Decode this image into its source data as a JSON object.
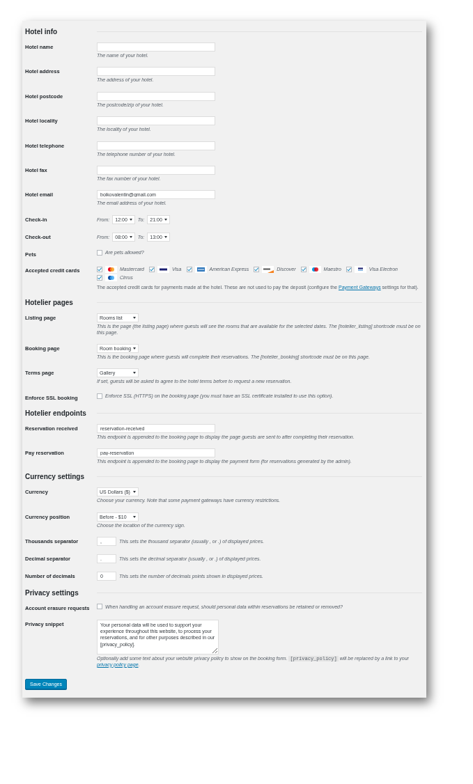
{
  "sections": [
    {
      "title": "Hotel info",
      "fields": [
        {
          "kind": "text",
          "label": "Hotel name",
          "description": "The name of your hotel."
        },
        {
          "kind": "text",
          "label": "Hotel address",
          "description": "The address of your hotel."
        },
        {
          "kind": "text",
          "label": "Hotel postcode",
          "description": "The postcode/zip of your hotel."
        },
        {
          "kind": "text",
          "label": "Hotel locality",
          "description": "The locality of your hotel."
        },
        {
          "kind": "text",
          "label": "Hotel telephone",
          "description": "The telephone number of your hotel."
        },
        {
          "kind": "text",
          "label": "Hotel fax",
          "description": "The fax number of your hotel."
        },
        {
          "kind": "text",
          "label": "Hotel email",
          "value": "boikovalentin@gmail.com",
          "description": "The email address of your hotel."
        },
        {
          "kind": "time",
          "label": "Check-in",
          "from_label": "From:",
          "from": "12:00",
          "to_label": "To:",
          "to": "21:00"
        },
        {
          "kind": "time",
          "label": "Check-out",
          "from_label": "From:",
          "from": "08:00",
          "to_label": "To:",
          "to": "13:00"
        },
        {
          "kind": "checkbox",
          "label": "Pets",
          "checked": false,
          "text": "Are pets allowed?"
        },
        {
          "kind": "cards",
          "label": "Accepted credit cards",
          "cards": [
            {
              "kind": "mastercard",
              "name": "Mastercard",
              "checked": true
            },
            {
              "kind": "visa",
              "name": "Visa",
              "checked": true
            },
            {
              "kind": "amex",
              "name": "American Express",
              "checked": true
            },
            {
              "kind": "discover",
              "name": "Discover",
              "checked": true
            },
            {
              "kind": "maestro",
              "name": "Maestro",
              "checked": true
            },
            {
              "kind": "visa-electron",
              "name": "Visa Electron",
              "checked": true
            },
            {
              "kind": "cirrus",
              "name": "Cirrus",
              "checked": true
            }
          ],
          "description": [
            {
              "kind": "text",
              "text": "The accepted credit cards for payments made at the hotel. These are not used to pay the deposit (configure the "
            },
            {
              "kind": "link",
              "text": "Payment Gateways"
            },
            {
              "kind": "text",
              "text": " settings for that)."
            }
          ]
        }
      ]
    },
    {
      "title": "Hotelier pages",
      "fields": [
        {
          "kind": "select",
          "label": "Listing page",
          "value": "Rooms list",
          "description": "This is the page (the listing page) where guests will see the rooms that are available for the selected dates. The [hotelier_listing] shortcode must be on this page."
        },
        {
          "kind": "select",
          "label": "Booking page",
          "value": "Room booking",
          "description": "This is the booking page where guests will complete their reservations. The [hotelier_booking] shortcode must be on this page."
        },
        {
          "kind": "select",
          "label": "Terms page",
          "value": "Gallery",
          "description": "If set, guests will be asked to agree to the hotel terms before to request a new reservation."
        },
        {
          "kind": "checkbox",
          "label": "Enforce SSL booking",
          "checked": false,
          "text": "Enforce SSL (HTTPS) on the booking page (you must have an SSL certificate installed to use this option)."
        }
      ]
    },
    {
      "title": "Hotelier endpoints",
      "fields": [
        {
          "kind": "text",
          "label": "Reservation received",
          "value": "reservation-received",
          "description": "This endpoint is appended to the booking page to display the page guests are sent to after completing their reservation."
        },
        {
          "kind": "text",
          "label": "Pay reservation",
          "value": "pay-reservation",
          "description": "This endpoint is appended to the booking page to display the payment form (for reservations generated by the admin)."
        }
      ]
    },
    {
      "title": "Currency settings",
      "fields": [
        {
          "kind": "select",
          "label": "Currency",
          "value": "US Dollars ($)",
          "description": "Choose your currency. Note that some payment gateways have currency restrictions."
        },
        {
          "kind": "select",
          "label": "Currency position",
          "value": "Before - $10",
          "description": "Choose the location of the currency sign."
        },
        {
          "kind": "small",
          "label": "Thousands separator",
          "value": ",",
          "description": "This sets the thousand separator (usually , or .) of displayed prices."
        },
        {
          "kind": "small",
          "label": "Decimal separator",
          "value": ".",
          "description": "This sets the decimal separator (usually , or .) of displayed prices."
        },
        {
          "kind": "small",
          "label": "Number of decimals",
          "value": "0",
          "description": "This sets the number of decimals points shown in displayed prices."
        }
      ]
    },
    {
      "title": "Privacy settings",
      "fields": [
        {
          "kind": "checkbox",
          "label": "Account erasure requests",
          "checked": false,
          "text": "When handling an account erasure request, should personal data within reservations be retained or removed?"
        },
        {
          "kind": "textarea",
          "label": "Privacy snippet",
          "value": "Your personal data will be used to support your experience throughout this website, to process your reservations, and for other purposes described in our [privacy_policy].",
          "description": [
            {
              "kind": "text",
              "text": "Optionally add some text about your website privacy policy to show on the booking form. "
            },
            {
              "kind": "code",
              "text": "[privacy_policy]"
            },
            {
              "kind": "text",
              "text": " will be replaced by a link to your "
            },
            {
              "kind": "link",
              "text": "privacy policy page"
            },
            {
              "kind": "text",
              "text": "."
            }
          ]
        }
      ]
    }
  ],
  "save_button": "Save Changes"
}
